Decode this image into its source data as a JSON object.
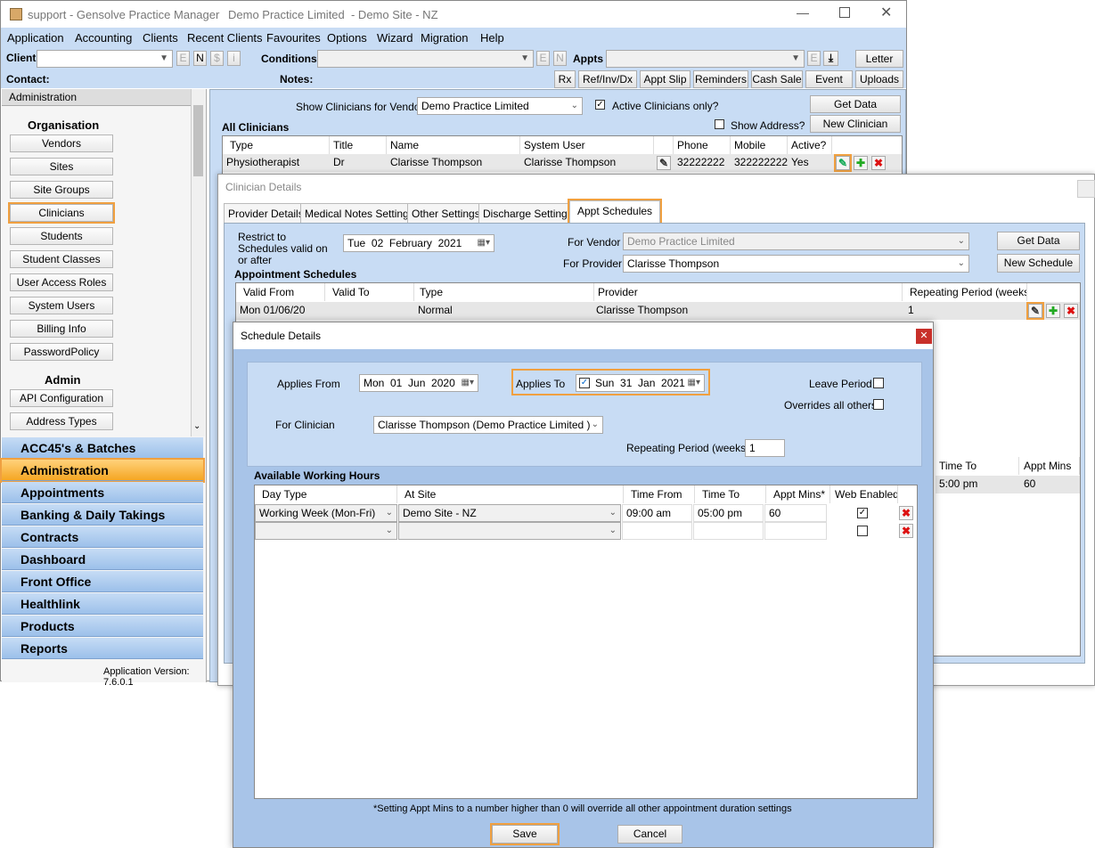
{
  "window": {
    "title": "support - Gensolve Practice Manager",
    "subtitle": "Demo Practice Limited  - Demo Site - NZ"
  },
  "menu": [
    "Application",
    "Accounting",
    "Clients",
    "Recent Clients",
    "Favourites",
    "Options",
    "Wizard",
    "Migration",
    "Help"
  ],
  "toolbar": {
    "client_label": "Client",
    "contact_label": "Contact:",
    "conditions_label": "Conditions",
    "notes_label": "Notes:",
    "appts_label": "Appts",
    "letter": "Letter",
    "small_buttons": [
      "E",
      "N",
      "$",
      "i"
    ],
    "cond_buttons": [
      "E",
      "N"
    ],
    "appts_e": "E",
    "action_buttons": [
      "Rx",
      "Ref/Inv/Dx",
      "Appt Slip",
      "Reminders",
      "Cash Sale",
      "Event",
      "Uploads"
    ]
  },
  "sidebar": {
    "header": "Administration",
    "organisation_heading": "Organisation",
    "organisation_items": [
      "Vendors",
      "Sites",
      "Site Groups",
      "Clinicians",
      "Students",
      "Student Classes",
      "User Access Roles",
      "System Users",
      "Billing Info",
      "PasswordPolicy"
    ],
    "admin_heading": "Admin",
    "admin_items": [
      "API Configuration",
      "Address Types"
    ],
    "sections": [
      "ACC45's & Batches",
      "Administration",
      "Appointments",
      "Banking & Daily Takings",
      "Contracts",
      "Dashboard",
      "Front Office",
      "Healthlink",
      "Products",
      "Reports"
    ],
    "version": "Application Version: 7.6.0.1"
  },
  "clinicians_panel": {
    "show_for_vendor_label": "Show Clinicians for Vendor",
    "vendor_value": "Demo Practice Limited",
    "active_only_label": "Active Clinicians only?",
    "show_address_label": "Show Address?",
    "get_data": "Get Data",
    "new_clinician": "New Clinician",
    "all_clinicians": "All Clinicians",
    "columns": [
      "Type",
      "Title",
      "Name",
      "System User",
      "",
      "Phone",
      "Mobile",
      "Active?"
    ],
    "row": [
      "Physiotherapist",
      "Dr",
      "Clarisse Thompson",
      "Clarisse Thompson",
      "",
      "32222222",
      "322222222",
      "Yes"
    ]
  },
  "clinician_details": {
    "title": "Clinician Details",
    "tabs": [
      "Provider Details",
      "Medical Notes Settings",
      "Other Settings",
      "Discharge Settings",
      "Appt Schedules"
    ],
    "restrict_label": "Restrict to Schedules valid on or after",
    "restrict_date": "Tue  02  February  2021",
    "for_vendor_label": "For Vendor",
    "for_vendor_value": "Demo Practice Limited",
    "for_provider_label": "For Provider",
    "for_provider_value": "Clarisse Thompson",
    "get_data": "Get Data",
    "new_schedule": "New Schedule",
    "appointment_schedules": "Appointment Schedules",
    "columns": [
      "Valid From",
      "Valid To",
      "Type",
      "Provider",
      "Repeating Period (weeks)"
    ],
    "row": [
      "Mon 01/06/20",
      "",
      "Normal",
      "Clarisse Thompson",
      "1"
    ],
    "right_columns": [
      "Time To",
      "Appt Mins"
    ],
    "right_row": [
      "5:00 pm",
      "60"
    ]
  },
  "schedule_details": {
    "title": "Schedule Details",
    "applies_from_label": "Applies From",
    "applies_from_value": "Mon  01  Jun  2020",
    "applies_to_label": "Applies To",
    "applies_to_value": "Sun  31  Jan  2021",
    "leave_period_label": "Leave Period",
    "overrides_label": "Overrides all others",
    "for_clinician_label": "For Clinician",
    "for_clinician_value": "Clarisse Thompson (Demo Practice Limited )",
    "repeating_label": "Repeating Period (weeks)",
    "repeating_value": "1",
    "available_hours": "Available Working Hours",
    "columns": [
      "Day Type",
      "At Site",
      "Time From",
      "Time To",
      "Appt Mins*",
      "Web Enabled"
    ],
    "rows": [
      {
        "day_type": "Working Week (Mon-Fri)",
        "site": "Demo Site - NZ",
        "from": "09:00 am",
        "to": "05:00 pm",
        "mins": "60",
        "web": true
      },
      {
        "day_type": "",
        "site": "",
        "from": "",
        "to": "",
        "mins": "",
        "web": false
      }
    ],
    "footnote": "*Setting Appt Mins to a number higher than 0 will override all other appointment duration settings",
    "save": "Save",
    "cancel": "Cancel"
  }
}
